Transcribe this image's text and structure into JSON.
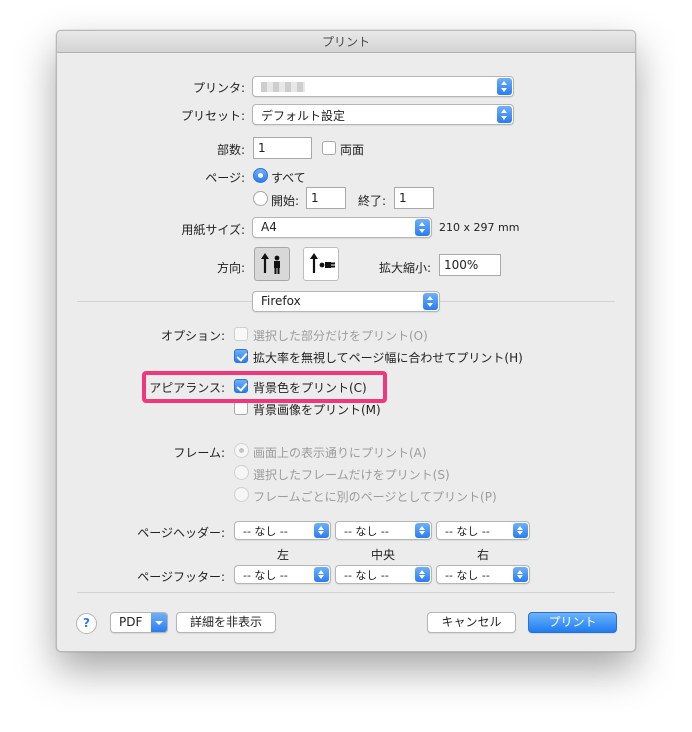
{
  "window": {
    "title": "プリント"
  },
  "printer": {
    "label": "プリンタ:",
    "value": ""
  },
  "preset": {
    "label": "プリセット:",
    "value": "デフォルト設定"
  },
  "copies": {
    "label": "部数:",
    "value": "1",
    "duplex_label": "両面"
  },
  "pages": {
    "label": "ページ:",
    "all_label": "すべて",
    "from_label": "開始:",
    "from_value": "1",
    "to_label": "終了:",
    "to_value": "1"
  },
  "paper": {
    "label": "用紙サイズ:",
    "value": "A4",
    "dimensions": "210 x 297 mm"
  },
  "orientation": {
    "label": "方向:"
  },
  "scale": {
    "label": "拡大縮小:",
    "value": "100%"
  },
  "section_popup": {
    "value": "Firefox"
  },
  "options": {
    "label": "オプション:",
    "print_selection": "選択した部分だけをプリント(O)",
    "shrink_to_fit": "拡大率を無視してページ幅に合わせてプリント(H)"
  },
  "appearance": {
    "label": "アピアランス:",
    "bg_colors": "背景色をプリント(C)",
    "bg_images": "背景画像をプリント(M)"
  },
  "frames": {
    "label": "フレーム:",
    "as_on_screen": "画面上の表示通りにプリント(A)",
    "selected_frame": "選択したフレームだけをプリント(S)",
    "each_frame": "フレームごとに別のページとしてプリント(P)"
  },
  "header": {
    "label": "ページヘッダー:",
    "left": "-- なし --",
    "center": "-- なし --",
    "right": "-- なし --"
  },
  "column_labels": {
    "left": "左",
    "center": "中央",
    "right": "右"
  },
  "footer": {
    "label": "ページフッター:",
    "left": "-- なし --",
    "center": "-- なし --",
    "right": "-- なし --"
  },
  "bottom": {
    "help": "?",
    "pdf": "PDF",
    "hide_details": "詳細を非表示",
    "cancel": "キャンセル",
    "print": "プリント"
  },
  "colors": {
    "accent": "#2a7cf0",
    "highlight": "#f0377b"
  }
}
